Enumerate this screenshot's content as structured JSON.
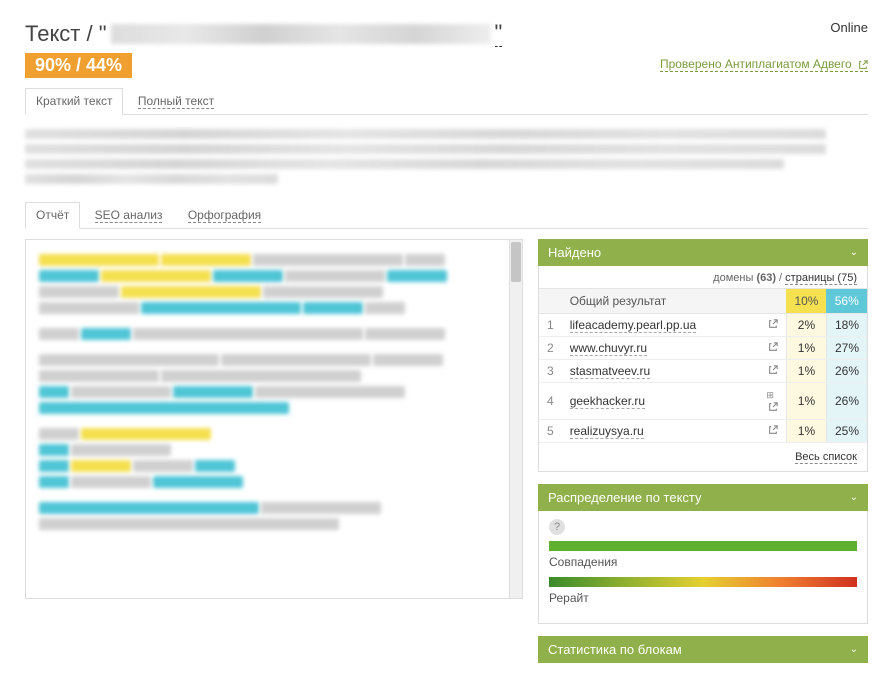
{
  "header": {
    "online": "Online",
    "title_prefix": "Текст / \"",
    "title_suffix": "\"",
    "badge": "90% / 44%",
    "verify": "Проверено Антиплагиатом Адвего"
  },
  "top_tabs": [
    {
      "label": "Краткий текст",
      "active": true
    },
    {
      "label": "Полный текст",
      "active": false
    }
  ],
  "sub_tabs": [
    {
      "label": "Отчёт",
      "active": true
    },
    {
      "label": "SEO анализ",
      "active": false
    },
    {
      "label": "Орфография",
      "active": false
    }
  ],
  "found": {
    "title": "Найдено",
    "domains_label": "домены",
    "domains_count": "(63)",
    "pages_label": "страницы (75)",
    "total_label": "Общий результат",
    "total_y": "10%",
    "total_c": "56%",
    "rows": [
      {
        "n": "1",
        "domain": "lifeacademy.pearl.pp.ua",
        "y": "2%",
        "c": "18%",
        "extra": false
      },
      {
        "n": "2",
        "domain": "www.chuvyr.ru",
        "y": "1%",
        "c": "27%",
        "extra": false
      },
      {
        "n": "3",
        "domain": "stasmatveev.ru",
        "y": "1%",
        "c": "26%",
        "extra": false
      },
      {
        "n": "4",
        "domain": "geekhacker.ru",
        "y": "1%",
        "c": "26%",
        "extra": true
      },
      {
        "n": "5",
        "domain": "realizuysya.ru",
        "y": "1%",
        "c": "25%",
        "extra": false
      }
    ],
    "full_list": "Весь список"
  },
  "distribution": {
    "title": "Распределение по тексту",
    "matches": "Совпадения",
    "rewrite": "Рерайт"
  },
  "stats": {
    "title": "Статистика по блокам"
  }
}
